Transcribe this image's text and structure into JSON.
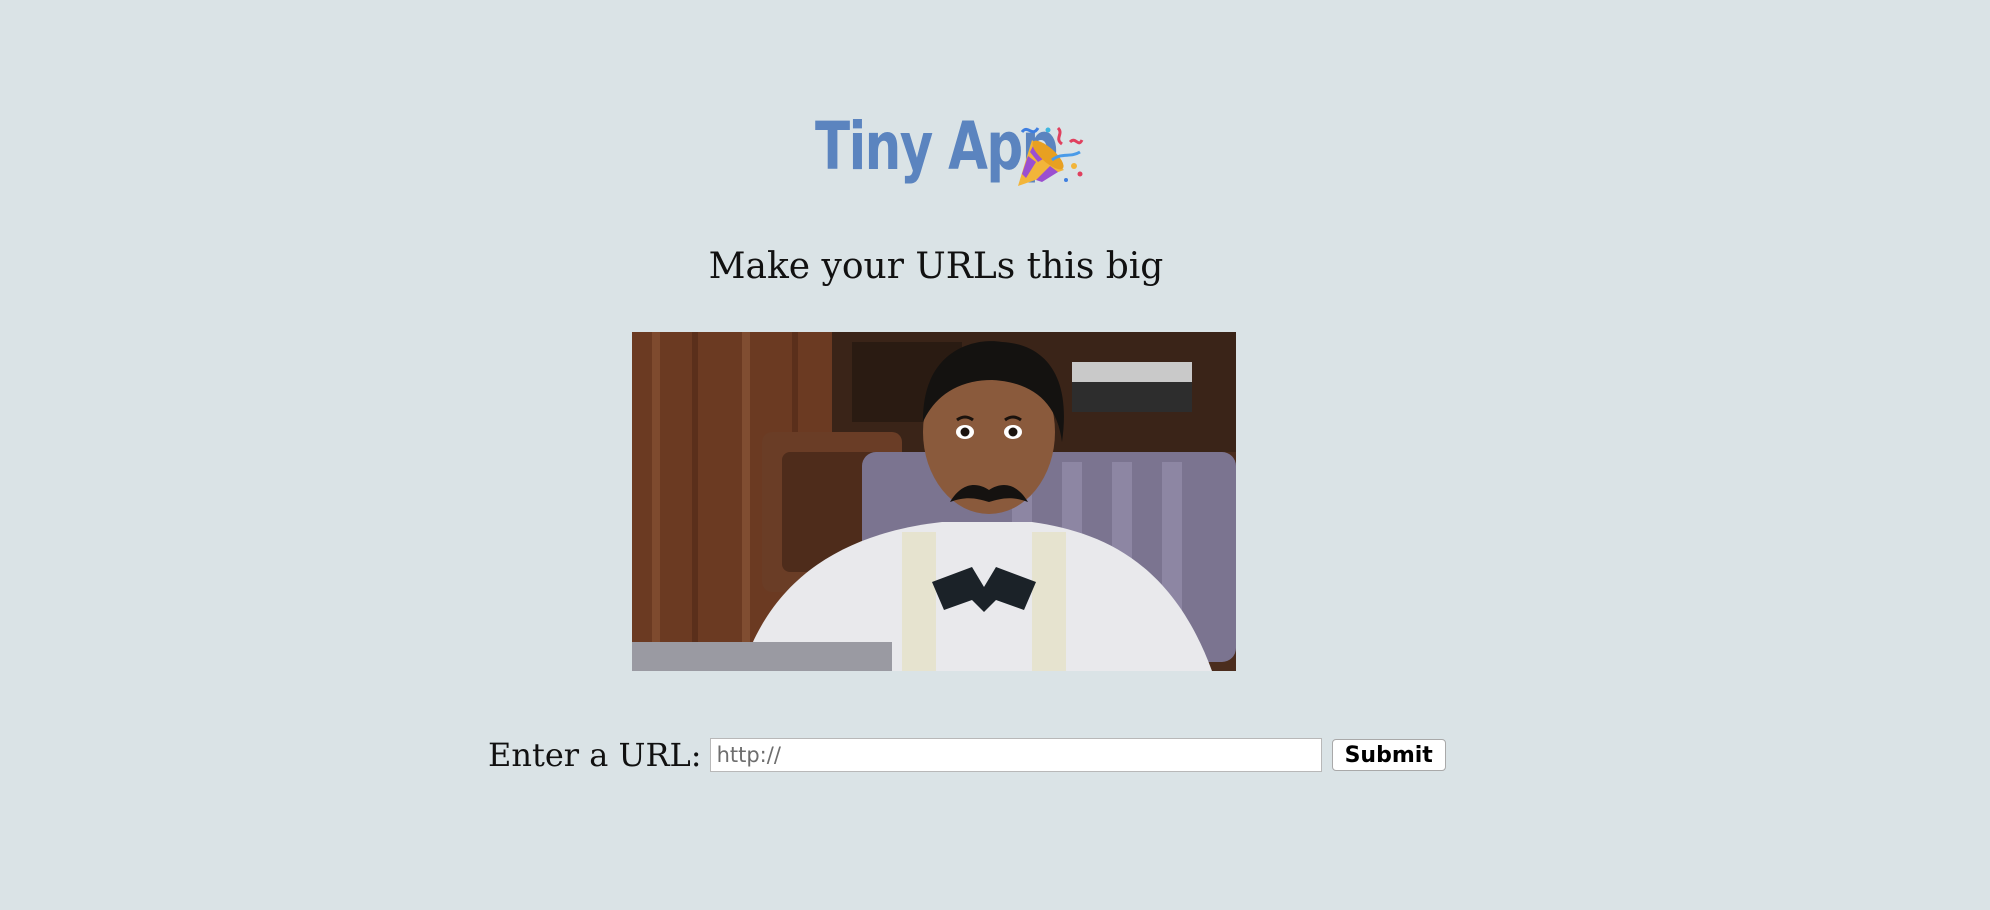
{
  "header": {
    "title": "Tiny App",
    "title_icon": "party-popper-icon",
    "title_color": "#5b84bf"
  },
  "tagline": "Make your URLs this big",
  "media": {
    "icon": "animated-gif-image"
  },
  "form": {
    "label": "Enter a URL:",
    "input_placeholder": "http://",
    "input_value": "",
    "submit_label": "Submit"
  },
  "colors": {
    "background": "#dae3e6"
  }
}
